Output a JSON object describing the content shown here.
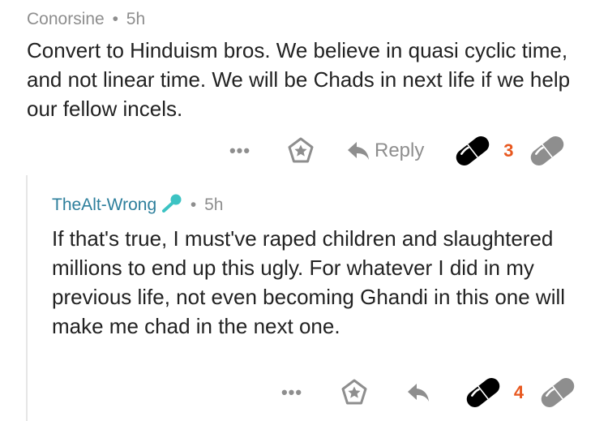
{
  "comments": [
    {
      "author": "Conorsine",
      "separator": "•",
      "age": "5h",
      "body": "Convert to Hinduism bros. We believe in quasi cyclic time, and not linear time. We will be Chads in next life if we help our fellow incels.",
      "more_label": "•••",
      "reply_label": "Reply",
      "score": "3"
    },
    {
      "author": "TheAlt-Wrong",
      "separator": "•",
      "age": "5h",
      "body": "If that's true, I must've raped children and slaughtered millions to end up this ugly. For whatever I did in my previous life, not even becoming Ghandi in this one will make me chad in the next one.",
      "more_label": "•••",
      "score": "4"
    }
  ],
  "colors": {
    "meta_gray": "#8e8e8e",
    "author_teal": "#2d7f9c",
    "flair_teal": "#3cc3c3",
    "score_orange": "#e8581f",
    "upvote_black": "#000000",
    "downvote_gray": "#8e8e8e"
  },
  "icons": [
    "more-icon",
    "star-icon",
    "reply-arrow-icon",
    "pill-upvote-icon",
    "pill-downvote-icon",
    "microphone-flair-icon"
  ]
}
